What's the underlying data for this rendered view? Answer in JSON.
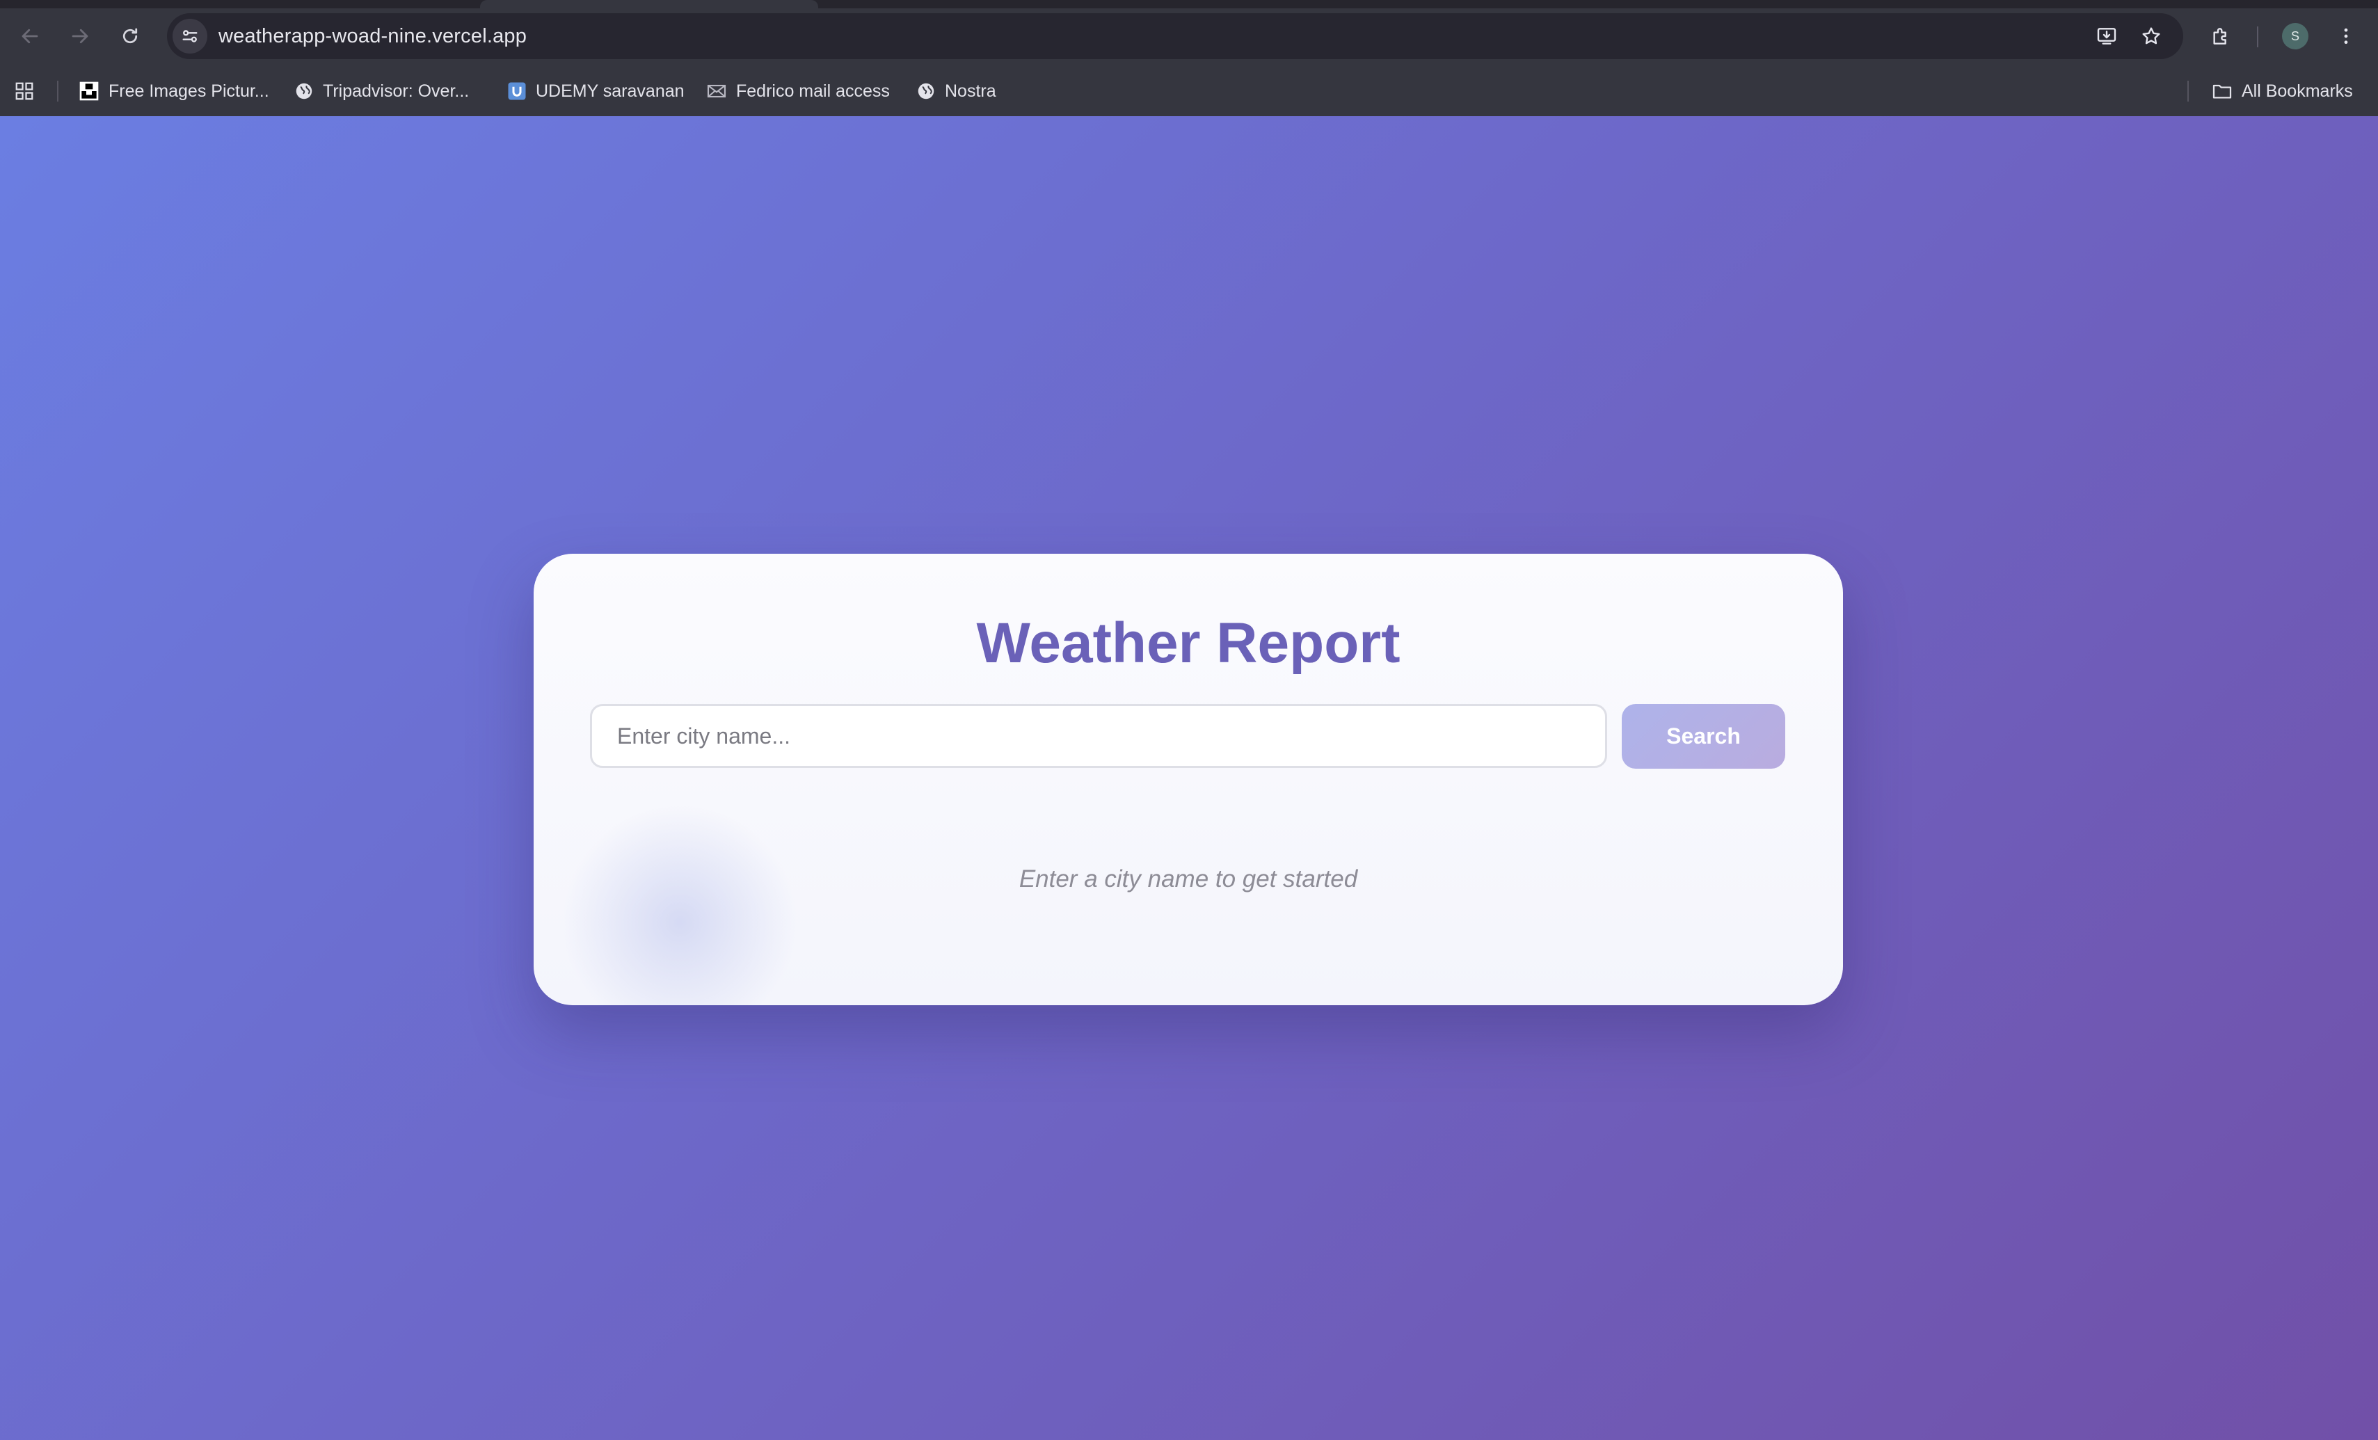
{
  "browser": {
    "url": "weatherapp-woad-nine.vercel.app",
    "profile_initial": "S",
    "icons": {
      "back": "arrow-left-icon",
      "forward": "arrow-right-icon",
      "reload": "reload-icon",
      "site_info": "tune-icon",
      "install": "install-app-icon",
      "bookmark": "star-icon",
      "extensions": "puzzle-icon",
      "menu": "kebab-menu-icon"
    }
  },
  "bookmarks": {
    "items": [
      {
        "label": "Free Images Pictur...",
        "icon": "unsplash-icon"
      },
      {
        "label": "Tripadvisor: Over...",
        "icon": "globe-icon"
      },
      {
        "label": "UDEMY saravanan",
        "icon": "udemy-icon"
      },
      {
        "label": "Fedrico mail access",
        "icon": "mail-icon"
      },
      {
        "label": "Nostra",
        "icon": "globe-icon"
      }
    ],
    "all_bookmarks_label": "All Bookmarks"
  },
  "app": {
    "title": "Weather Report",
    "search_placeholder": "Enter city name...",
    "search_value": "",
    "search_button_label": "Search",
    "hint": "Enter a city name to get started"
  },
  "colors": {
    "gradient_start": "#6b7ee2",
    "gradient_end": "#7150a8",
    "title": "#6a61b8",
    "button": "#aeb3ea"
  }
}
